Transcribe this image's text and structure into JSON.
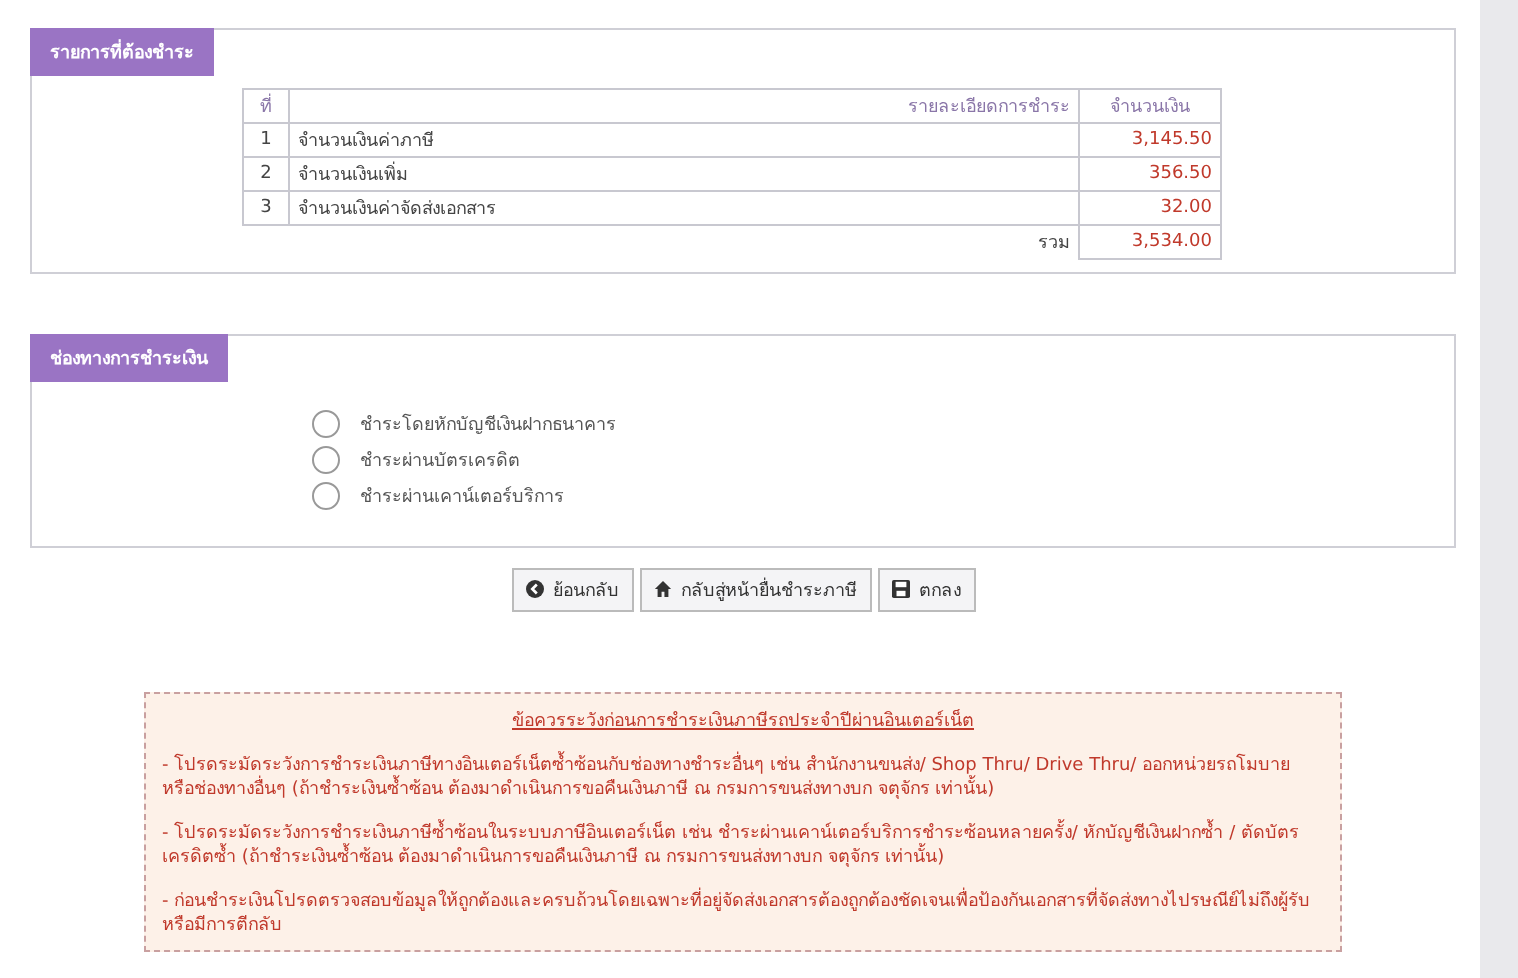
{
  "payment_items": {
    "title": "รายการที่ต้องชำระ",
    "columns": [
      "ที่",
      "รายละเอียดการชำระ",
      "จำนวนเงิน"
    ],
    "rows": [
      {
        "no": "1",
        "detail": "จำนวนเงินค่าภาษี",
        "amount": "3,145.50"
      },
      {
        "no": "2",
        "detail": "จำนวนเงินเพิ่ม",
        "amount": "356.50"
      },
      {
        "no": "3",
        "detail": "จำนวนเงินค่าจัดส่งเอกสาร",
        "amount": "32.00"
      }
    ],
    "total_label": "รวม",
    "total": "3,534.00"
  },
  "payment_channels": {
    "title": "ช่องทางการชำระเงิน",
    "options": [
      {
        "label": "ชำระโดยหักบัญชีเงินฝากธนาคาร",
        "selected": false
      },
      {
        "label": "ชำระผ่านบัตรเครดิต",
        "selected": false
      },
      {
        "label": "ชำระผ่านเคาน์เตอร์บริการ",
        "selected": false
      }
    ]
  },
  "buttons": [
    {
      "kind": "back",
      "label": "ย้อนกลับ"
    },
    {
      "kind": "home",
      "label": "กลับสู่หน้ายื่นชำระภาษี"
    },
    {
      "kind": "save",
      "label": "ตกลง"
    }
  ],
  "notice": {
    "title": "ข้อควรระวังก่อนการชำระเงินภาษีรถประจำปีผ่านอินเตอร์เน็ต",
    "paragraphs": [
      "- โปรดระมัดระวังการชำระเงินภาษีทางอินเตอร์เน็ตซ้ำซ้อนกับช่องทางชำระอื่นๆ เช่น สำนักงานขนส่ง/ Shop Thru/ Drive Thru/ ออกหน่วยรถโมบาย หรือช่องทางอื่นๆ (ถ้าชำระเงินซ้ำซ้อน ต้องมาดำเนินการขอคืนเงินภาษี ณ กรมการขนส่งทางบก จตุจักร เท่านั้น)",
      "- โปรดระมัดระวังการชำระเงินภาษีซ้ำซ้อนในระบบภาษีอินเตอร์เน็ต เช่น ชำระผ่านเคาน์เตอร์บริการชำระซ้อนหลายครั้ง/ หักบัญชีเงินฝากซ้ำ / ตัดบัตรเครดิตซ้ำ (ถ้าชำระเงินซ้ำซ้อน ต้องมาดำเนินการขอคืนเงินภาษี ณ กรมการขนส่งทางบก จตุจักร เท่านั้น)",
      "- ก่อนชำระเงินโปรดตรวจสอบข้อมูลให้ถูกต้องและครบถ้วนโดยเฉพาะที่อยู่จัดส่งเอกสารต้องถูกต้องชัดเจนเพื่อป้องกันเอกสารที่จัดส่งทางไปรษณีย์ไม่ถึงผู้รับหรือมีการตีกลับ"
    ]
  }
}
